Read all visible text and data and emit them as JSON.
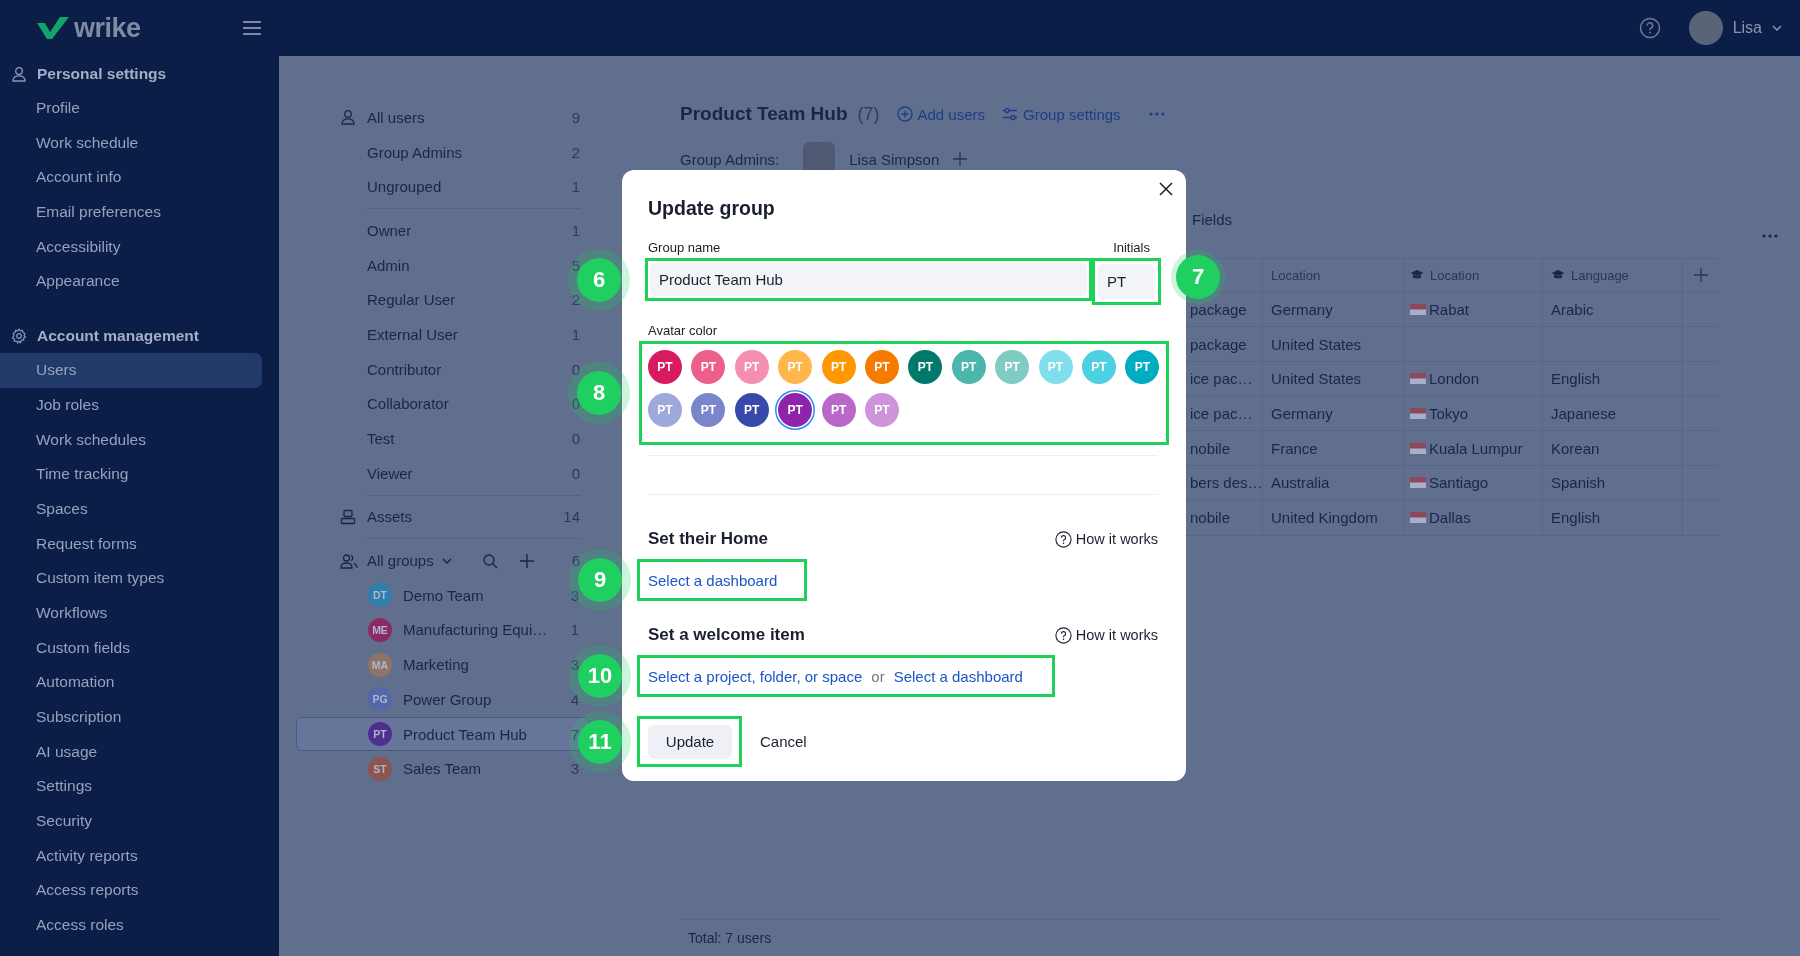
{
  "top_bar": {
    "logo": "wrike",
    "user_name": "Lisa"
  },
  "sidebar": {
    "sections": [
      {
        "title": "Personal settings",
        "kind": "person",
        "items": [
          {
            "label": "Profile",
            "selected": false
          },
          {
            "label": "Work schedule",
            "selected": false
          },
          {
            "label": "Account info",
            "selected": false
          },
          {
            "label": "Email preferences",
            "selected": false
          },
          {
            "label": "Accessibility",
            "selected": false
          },
          {
            "label": "Appearance",
            "selected": false
          }
        ]
      },
      {
        "title": "Account management",
        "kind": "gear",
        "items": [
          {
            "label": "Users",
            "selected": true
          },
          {
            "label": "Job roles",
            "selected": false
          },
          {
            "label": "Work schedules",
            "selected": false
          },
          {
            "label": "Time tracking",
            "selected": false
          },
          {
            "label": "Spaces",
            "selected": false
          },
          {
            "label": "Request forms",
            "selected": false
          },
          {
            "label": "Custom item types",
            "selected": false
          },
          {
            "label": "Workflows",
            "selected": false
          },
          {
            "label": "Custom fields",
            "selected": false
          },
          {
            "label": "Automation",
            "selected": false
          },
          {
            "label": "Subscription",
            "selected": false
          },
          {
            "label": "AI usage",
            "selected": false
          },
          {
            "label": "Settings",
            "selected": false
          },
          {
            "label": "Security",
            "selected": false
          },
          {
            "label": "Activity reports",
            "selected": false
          },
          {
            "label": "Access reports",
            "selected": false
          },
          {
            "label": "Access roles",
            "selected": false
          }
        ]
      }
    ]
  },
  "user_filters": [
    [
      {
        "label": "All users",
        "count": "9",
        "kind": "users"
      },
      {
        "label": "Group Admins",
        "count": "2",
        "kind": "plain"
      },
      {
        "label": "Ungrouped",
        "count": "1",
        "kind": "plain"
      }
    ],
    [
      {
        "label": "Owner",
        "count": "1",
        "kind": "plain"
      },
      {
        "label": "Admin",
        "count": "5",
        "kind": "plain"
      },
      {
        "label": "Regular User",
        "count": "2",
        "kind": "plain"
      },
      {
        "label": "External User",
        "count": "1",
        "kind": "plain"
      },
      {
        "label": "Contributor",
        "count": "0",
        "kind": "plain"
      },
      {
        "label": "Collaborator",
        "count": "0",
        "kind": "plain"
      },
      {
        "label": "Test",
        "count": "0",
        "kind": "plain"
      },
      {
        "label": "Viewer",
        "count": "0",
        "kind": "plain"
      }
    ],
    [
      {
        "label": "Assets",
        "count": "14",
        "kind": "assets"
      }
    ]
  ],
  "groups": {
    "title": "All groups",
    "count": "6",
    "items": [
      {
        "initials": "DT",
        "name": "Demo Team",
        "count": "3",
        "color": "#2f7fae",
        "selected": false
      },
      {
        "initials": "ME",
        "name": "Manufacturing Equi…",
        "count": "1",
        "color": "#8e2a63",
        "selected": false
      },
      {
        "initials": "MA",
        "name": "Marketing",
        "count": "3",
        "color": "#8f7466",
        "selected": false
      },
      {
        "initials": "PG",
        "name": "Power Group",
        "count": "4",
        "color": "#5467a8",
        "selected": false
      },
      {
        "initials": "PT",
        "name": "Product Team Hub",
        "count": "7",
        "color": "#4e2f8f",
        "selected": true
      },
      {
        "initials": "ST",
        "name": "Sales Team",
        "count": "3",
        "color": "#8d5550",
        "selected": false
      }
    ]
  },
  "group_header": {
    "title": "Product Team Hub",
    "count": "(7)",
    "actions": [
      {
        "label": "Add users",
        "kind": "add"
      },
      {
        "label": "Group settings",
        "kind": "settings"
      }
    ],
    "admins_label": "Group Admins:",
    "admin_name": "Lisa Simpson"
  },
  "tab": "Fields",
  "table": {
    "columns": [
      {
        "kind": "cut"
      },
      {
        "label": "Location",
        "kind": "plain"
      },
      {
        "label": "Location",
        "kind": "education"
      },
      {
        "label": "Language",
        "kind": "education"
      }
    ],
    "rows": [
      {
        "column_1": "package",
        "location": "Germany",
        "city": "Rabat",
        "language": "Arabic"
      },
      {
        "column_1": "package",
        "location": "United States"
      },
      {
        "column_1": "ice pac…",
        "location": "United States",
        "city": "London",
        "language": "English"
      },
      {
        "column_1": "ice pac…",
        "location": "Germany",
        "city": "Tokyo",
        "language": "Japanese"
      },
      {
        "column_1": "nobile",
        "location": "France",
        "city": "Kuala Lumpur",
        "language": "Korean"
      },
      {
        "column_1": "bers des…",
        "location": "Australia",
        "city": "Santiago",
        "language": "Spanish"
      },
      {
        "column_1": "nobile",
        "location": "United Kingdom",
        "city": "Dallas",
        "language": "English"
      }
    ],
    "total": "Total: 7 users"
  },
  "modal": {
    "title": "Update group",
    "group_name_label": "Group name",
    "group_name": "Product Team Hub",
    "initials_label": "Initials",
    "initials": "PT",
    "avatar_color_label": "Avatar color",
    "colors": [
      {
        "initials": "PT",
        "color": "#d81b60",
        "selected": false
      },
      {
        "initials": "PT",
        "color": "#ec5f8a",
        "selected": false
      },
      {
        "initials": "PT",
        "color": "#f48fb1",
        "selected": false
      },
      {
        "initials": "PT",
        "color": "#ffb74d",
        "selected": false
      },
      {
        "initials": "PT",
        "color": "#ff9800",
        "selected": false
      },
      {
        "initials": "PT",
        "color": "#f57c00",
        "selected": false
      },
      {
        "initials": "PT",
        "color": "#00796b",
        "selected": false
      },
      {
        "initials": "PT",
        "color": "#4db6ac",
        "selected": false
      },
      {
        "initials": "PT",
        "color": "#80cbc4",
        "selected": false
      },
      {
        "initials": "PT",
        "color": "#80deea",
        "selected": false
      },
      {
        "initials": "PT",
        "color": "#4dd0e1",
        "selected": false
      },
      {
        "initials": "PT",
        "color": "#00acc1",
        "selected": false
      },
      {
        "initials": "PT",
        "color": "#9fa8da",
        "selected": false
      },
      {
        "initials": "PT",
        "color": "#7986cb",
        "selected": false
      },
      {
        "initials": "PT",
        "color": "#3949ab",
        "selected": false
      },
      {
        "initials": "PT",
        "color": "#8e24aa",
        "selected": true
      },
      {
        "initials": "PT",
        "color": "#ba68c8",
        "selected": false
      },
      {
        "initials": "PT",
        "color": "#ce93d8",
        "selected": false
      }
    ],
    "home": {
      "title": "Set their Home",
      "help": "How it works",
      "link": "Select a dashboard"
    },
    "welcome": {
      "title": "Set a welcome item",
      "help": "How it works",
      "links": [
        "Select a project, folder, or space",
        "Select a dashboard"
      ],
      "separator": "or"
    },
    "primary_button": "Update",
    "secondary_button": "Cancel"
  },
  "callouts": {
    "group_name": "6",
    "initials": "7",
    "avatar_color": "8",
    "home": "9",
    "welcome": "10",
    "update": "11"
  }
}
